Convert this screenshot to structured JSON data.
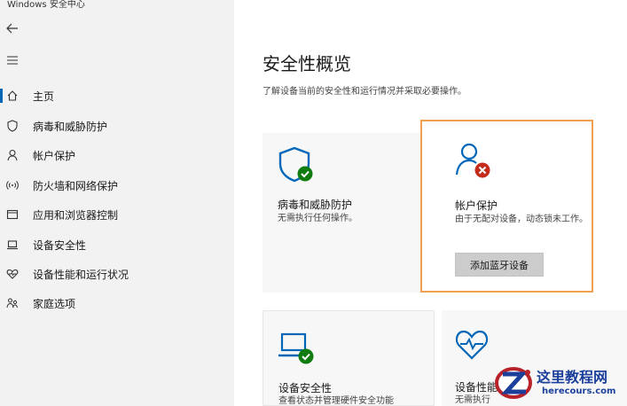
{
  "window": {
    "title": "Windows 安全中心"
  },
  "sidebar": {
    "items": [
      {
        "label": "主页",
        "icon": "home-icon"
      },
      {
        "label": "病毒和威胁防护",
        "icon": "shield-icon"
      },
      {
        "label": "帐户保护",
        "icon": "person-icon"
      },
      {
        "label": "防火墙和网络保护",
        "icon": "wireless-icon"
      },
      {
        "label": "应用和浏览器控制",
        "icon": "app-window-icon"
      },
      {
        "label": "设备安全性",
        "icon": "laptop-icon"
      },
      {
        "label": "设备性能和运行状况",
        "icon": "heart-icon"
      },
      {
        "label": "家庭选项",
        "icon": "family-icon"
      }
    ],
    "active_index": 0
  },
  "main": {
    "title": "安全性概览",
    "subtitle": "了解设备当前的安全性和运行情况并采取必要操作。",
    "cards": [
      {
        "title": "病毒和威胁防护",
        "desc": "无需执行任何操作。",
        "icon": "shield-check-icon",
        "status": "ok"
      },
      {
        "title": "帐户保护",
        "desc": "由于无配对设备，动态锁未工作。",
        "icon": "person-error-icon",
        "status": "warning",
        "button": "添加蓝牙设备"
      },
      {
        "title": "设备安全性",
        "desc": "查看状态并管理硬件安全功能",
        "icon": "laptop-check-icon",
        "status": "ok"
      },
      {
        "title": "设备性能",
        "desc": "无需执行",
        "icon": "heart-pulse-icon",
        "status": "ok"
      }
    ]
  },
  "colors": {
    "accent": "#0067b8",
    "ok": "#107c10",
    "error": "#c42b1c",
    "highlight_border": "#f0a050"
  },
  "watermark": {
    "line1": "这里教程网",
    "line2": "herecours.com"
  }
}
